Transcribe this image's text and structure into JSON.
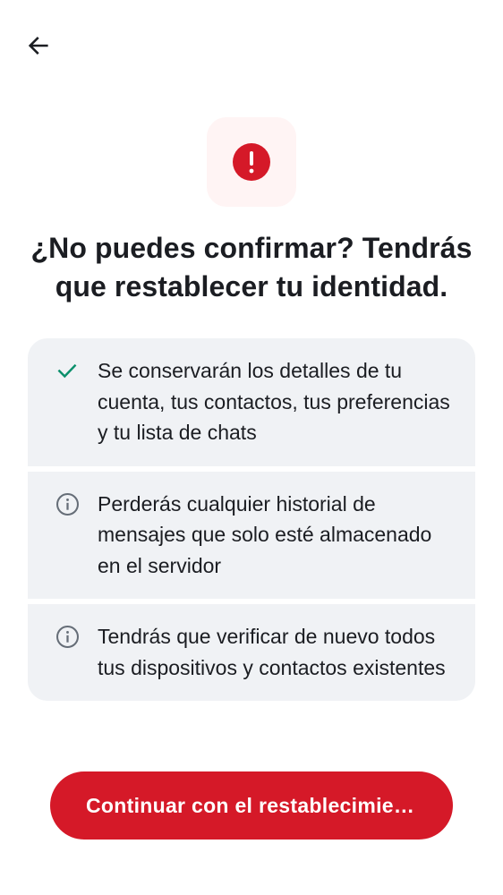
{
  "header": {
    "back_icon": "arrow-left-icon"
  },
  "alert": {
    "icon": "exclamation-circle-icon",
    "color": "#d51928",
    "background": "#fff4f4"
  },
  "title": {
    "line1": "¿No puedes confirmar? Tendrás",
    "line2": "que restablecer tu identidad."
  },
  "info_items": [
    {
      "icon": "check-icon",
      "icon_color": "#0a8f6b",
      "text": "Se conservarán los detalles de tu cuenta, tus contactos, tus preferencias y tu lista de chats"
    },
    {
      "icon": "info-icon",
      "icon_color": "#656d77",
      "text": "Perderás cualquier historial de mensajes que solo esté almacenado en el servidor"
    },
    {
      "icon": "info-icon",
      "icon_color": "#656d77",
      "text": "Tendrás que verificar de nuevo todos tus dispositivos y contactos existentes"
    }
  ],
  "primary_button": {
    "label": "Continuar con el restablecimiento",
    "color": "#d51928"
  }
}
